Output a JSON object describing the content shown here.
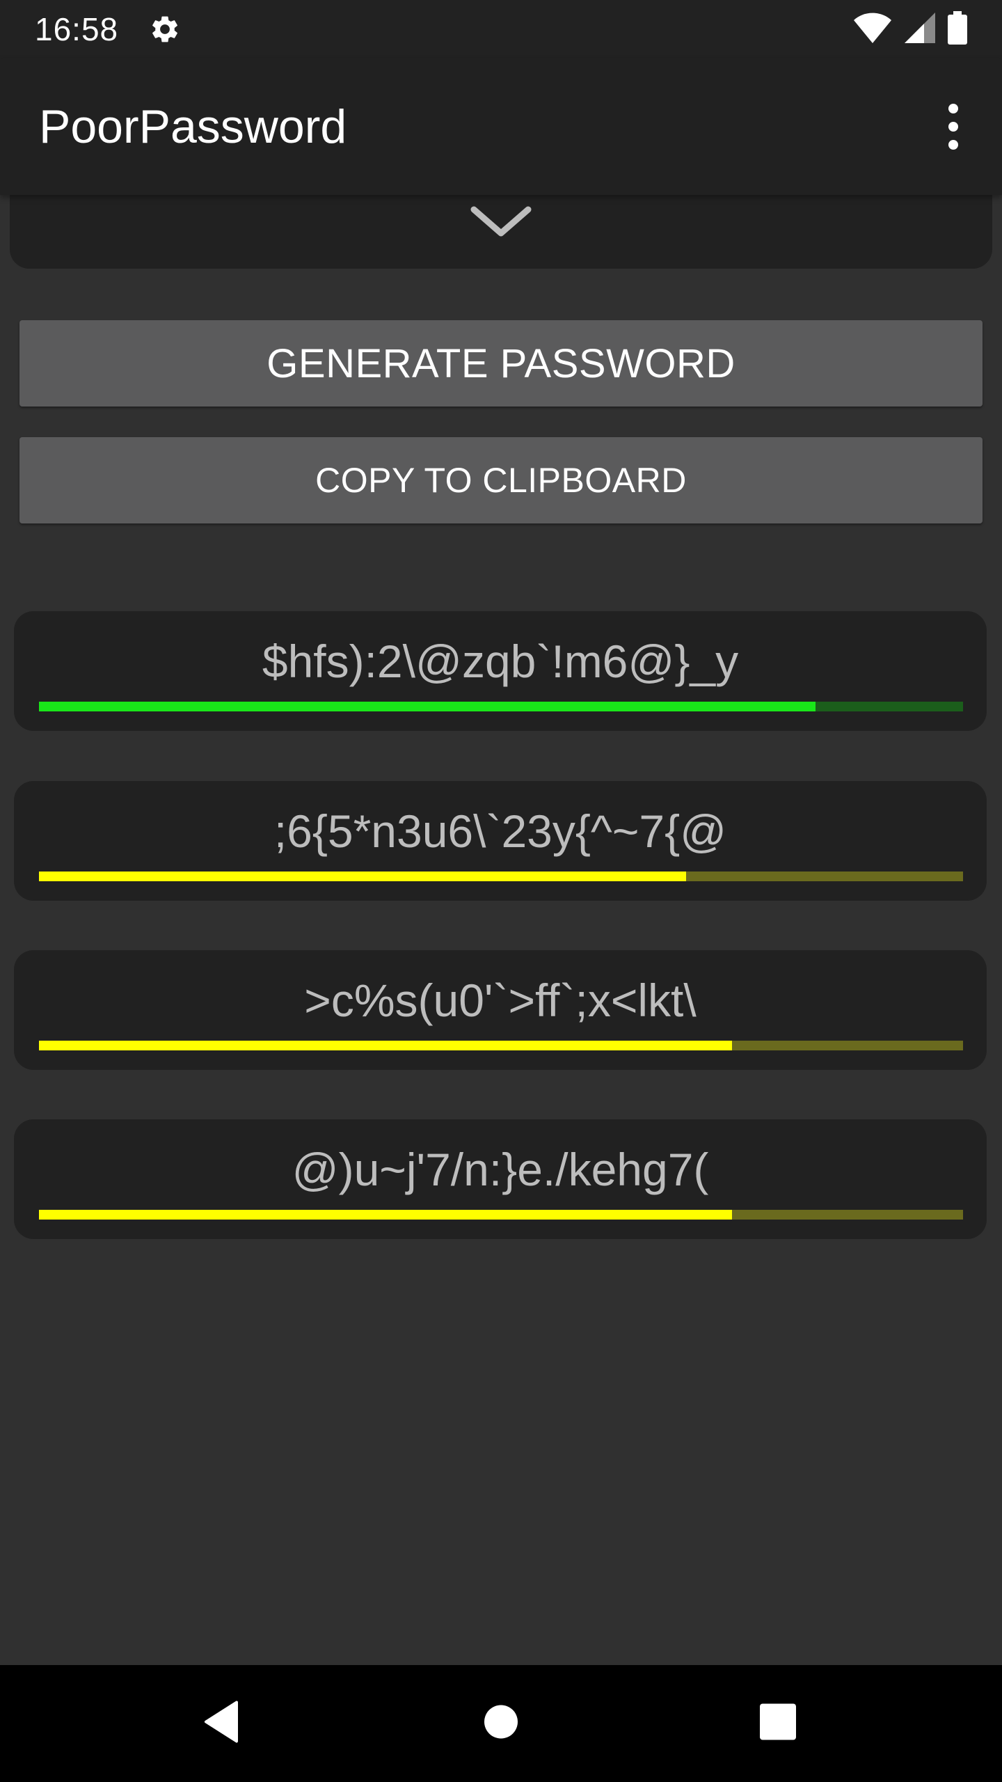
{
  "status_bar": {
    "time": "16:58",
    "icons": [
      "gear-icon",
      "wifi-icon",
      "cell-signal-icon",
      "battery-icon"
    ]
  },
  "app_bar": {
    "title": "PoorPassword",
    "menu_icon": "more-vert-icon"
  },
  "options_panel": {
    "expand_icon": "chevron-down-icon"
  },
  "buttons": {
    "generate_label": "GENERATE PASSWORD",
    "copy_label": "COPY TO CLIPBOARD"
  },
  "passwords": [
    {
      "text": "$hfs):2\\@zqb`!m6@}_y",
      "strength": 0.84,
      "bar_color": "#19e619",
      "track_color": "#1b5e1b"
    },
    {
      "text": ";6{5*n3u6\\`23y{^~7{@",
      "strength": 0.7,
      "bar_color": "#ffff00",
      "track_color": "#6a6a1e"
    },
    {
      "text": ">c%s(u0'`>ff`;x<lkt\\",
      "strength": 0.75,
      "bar_color": "#ffff00",
      "track_color": "#6a6a1e"
    },
    {
      "text": "@)u~j'7/n:}e./kehg7(",
      "strength": 0.75,
      "bar_color": "#ffff00",
      "track_color": "#6a6a1e"
    }
  ],
  "nav_bar": {
    "icons": [
      "back-icon",
      "home-icon",
      "recents-icon"
    ]
  },
  "colors": {
    "background": "#303030",
    "app_bar": "#212121",
    "button": "#5b5b5c",
    "password_text": "#bdbdbd"
  }
}
